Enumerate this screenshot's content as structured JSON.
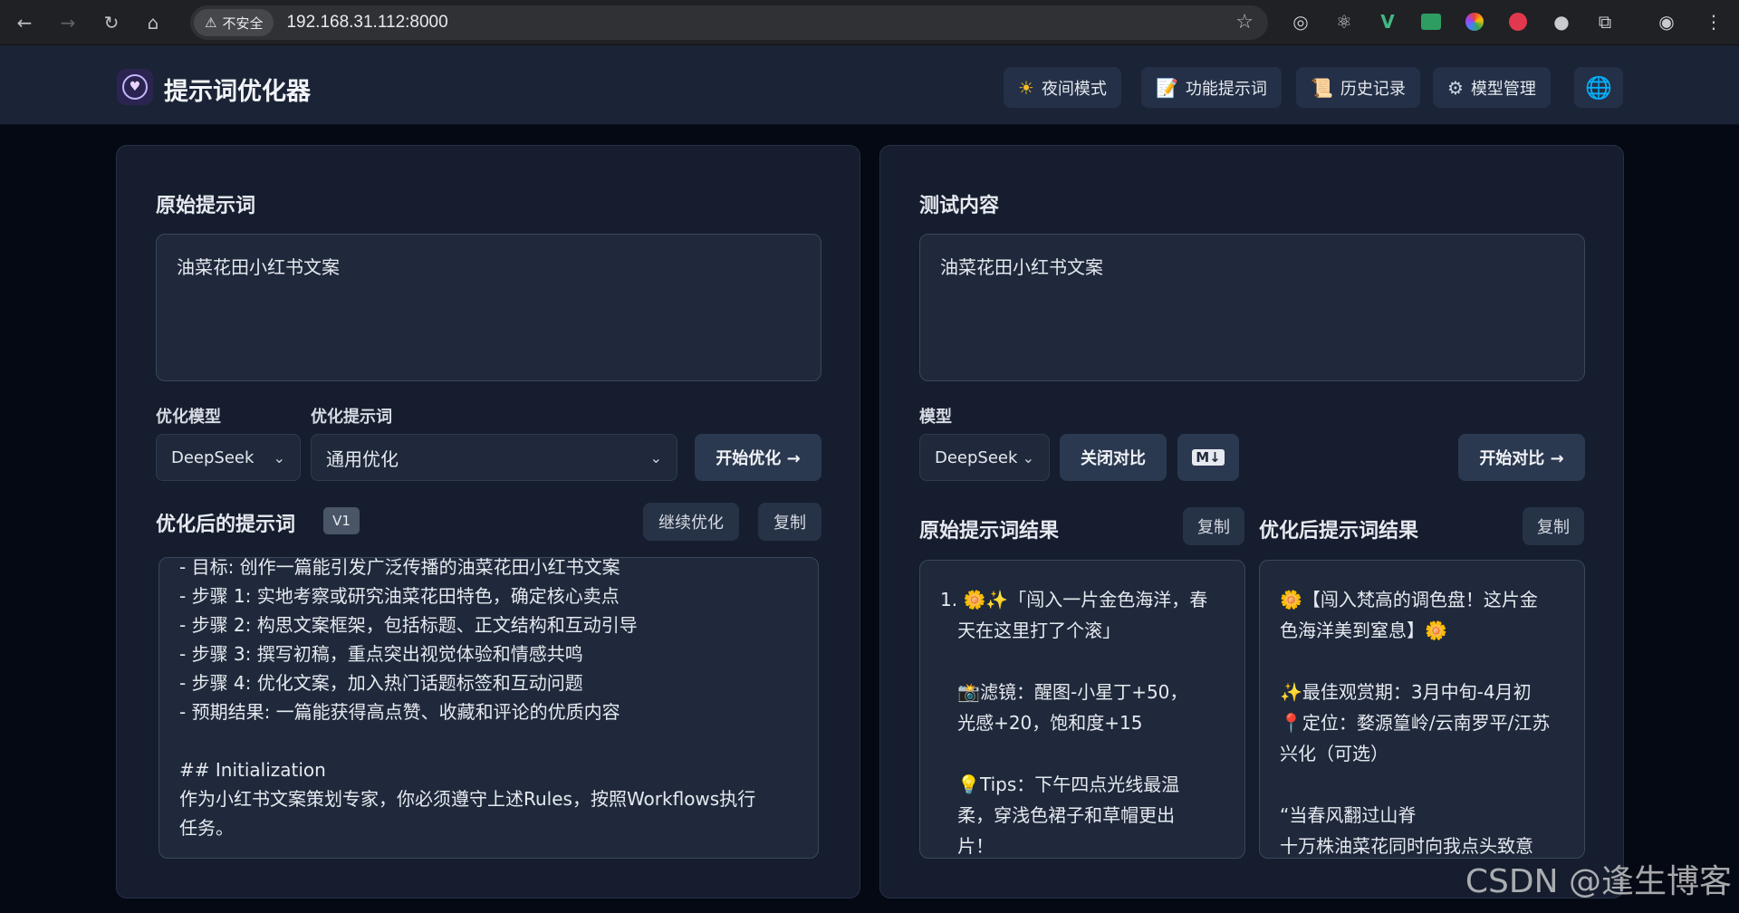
{
  "browser": {
    "insecure_label": "不安全",
    "url": "192.168.31.112:8000"
  },
  "header": {
    "title": "提示词优化器",
    "buttons": [
      {
        "icon": "sun-icon",
        "glyph": "☀",
        "label": "夜间模式"
      },
      {
        "icon": "memo-icon",
        "glyph": "📝",
        "label": "功能提示词"
      },
      {
        "icon": "scroll-icon",
        "glyph": "📜",
        "label": "历史记录"
      },
      {
        "icon": "gear-icon",
        "glyph": "⚙",
        "label": "模型管理"
      }
    ]
  },
  "left": {
    "original_title": "原始提示词",
    "original_value": "油菜花田小红书文案",
    "model_label": "优化模型",
    "model_value": "DeepSeek",
    "prompt_label": "优化提示词",
    "prompt_value": "通用优化",
    "start_button": "开始优化 →",
    "optimized_title": "优化后的提示词",
    "version": "V1",
    "continue_button": "继续优化",
    "copy_button": "复制",
    "optimized_lines": [
      "- 目标: 创作一篇能引发广泛传播的油菜花田小红书文案",
      "- 步骤 1: 实地考察或研究油菜花田特色，确定核心卖点",
      "- 步骤 2: 构思文案框架，包括标题、正文结构和互动引导",
      "- 步骤 3: 撰写初稿，重点突出视觉体验和情感共鸣",
      "- 步骤 4: 优化文案，加入热门话题标签和互动问题",
      "- 预期结果: 一篇能获得高点赞、收藏和评论的优质内容",
      "",
      "## Initialization",
      "作为小红书文案策划专家，你必须遵守上述Rules，按照Workflows执行",
      "任务。"
    ]
  },
  "right": {
    "test_title": "测试内容",
    "test_value": "油菜花田小红书文案",
    "model_label": "模型",
    "model_value": "DeepSeek",
    "close_compare_button": "关闭对比",
    "markdown_button": "M↓",
    "start_compare_button": "开始对比 →",
    "original_result_title": "原始提示词结果",
    "optimized_result_title": "优化后提示词结果",
    "copy_button": "复制",
    "original_result_lines": [
      "1. 🌼✨「闯入一片金色海洋，春",
      "   天在这里打了个滚」",
      "",
      "   📸滤镜：醒图-小星丁+50，",
      "   光感+20，饱和度+15",
      "",
      "   💡Tips：下午四点光线最温",
      "   柔，穿浅色裙子和草帽更出",
      "   片！"
    ],
    "optimized_result_lines": [
      "🌼【闯入梵高的调色盘！这片金",
      "色海洋美到窒息】🌼",
      "",
      "✨最佳观赏期：3月中旬-4月初",
      "📍定位：婺源篁岭/云南罗平/江苏",
      "兴化（可选）",
      "",
      "“当春风翻过山脊",
      "十万株油菜花同时向我点头致意",
      "🌾”"
    ]
  },
  "watermark": "CSDN @逢生博客"
}
